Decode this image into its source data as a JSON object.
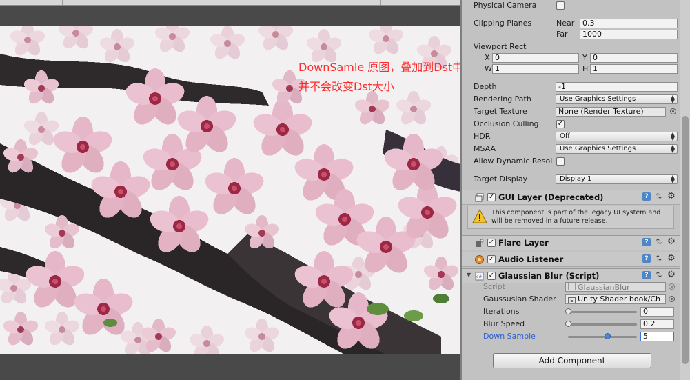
{
  "annotation": {
    "line1": "DownSamle 原图，叠加到Dst中",
    "line2": "并不会改变Dst大小"
  },
  "camera": {
    "physical_camera_label": "Physical Camera",
    "physical_camera_checked": false,
    "clipping_planes_label": "Clipping Planes",
    "near_label": "Near",
    "near_value": "0.3",
    "far_label": "Far",
    "far_value": "1000",
    "viewport_rect_label": "Viewport Rect",
    "x_label": "X",
    "x_value": "0",
    "y_label": "Y",
    "y_value": "0",
    "w_label": "W",
    "w_value": "1",
    "h_label": "H",
    "h_value": "1",
    "depth_label": "Depth",
    "depth_value": "-1",
    "rendering_path_label": "Rendering Path",
    "rendering_path_value": "Use Graphics Settings",
    "target_texture_label": "Target Texture",
    "target_texture_value": "None (Render Texture)",
    "occlusion_culling_label": "Occlusion Culling",
    "occlusion_culling_checked": true,
    "hdr_label": "HDR",
    "hdr_value": "Off",
    "msaa_label": "MSAA",
    "msaa_value": "Use Graphics Settings",
    "allow_dynamic_label": "Allow Dynamic Resol",
    "allow_dynamic_checked": false,
    "target_display_label": "Target Display",
    "target_display_value": "Display 1"
  },
  "gui_layer": {
    "title": "GUI Layer (Deprecated)",
    "enabled": true,
    "warning": "This component is part of the legacy UI system and will be removed in a future release."
  },
  "flare_layer": {
    "title": "Flare Layer",
    "enabled": true
  },
  "audio_listener": {
    "title": "Audio Listener",
    "enabled": true
  },
  "gaussian_blur": {
    "title": "Glaussian Blur (Script)",
    "enabled": true,
    "script_label": "Script",
    "script_value": "GlaussianBlur",
    "shader_label": "Gaussusian Shader",
    "shader_value": "Unity Shader book/Ch",
    "iterations_label": "Iterations",
    "iterations_value": "0",
    "blur_speed_label": "Blur Speed",
    "blur_speed_value": "0.2",
    "down_sample_label": "Down Sample",
    "down_sample_value": "5",
    "sliders": {
      "iterations_fraction": 0.0,
      "blur_speed_fraction": 0.0,
      "down_sample_fraction": 0.57
    }
  },
  "add_component_label": "Add Component",
  "colors": {
    "annotation": "#ff2a2a",
    "active_label": "#2b5fd0",
    "help_button": "#4f86c6"
  },
  "icons": {
    "gear": "gear-icon",
    "help": "help-icon",
    "preset": "preset-icon",
    "warning": "warning-icon"
  }
}
